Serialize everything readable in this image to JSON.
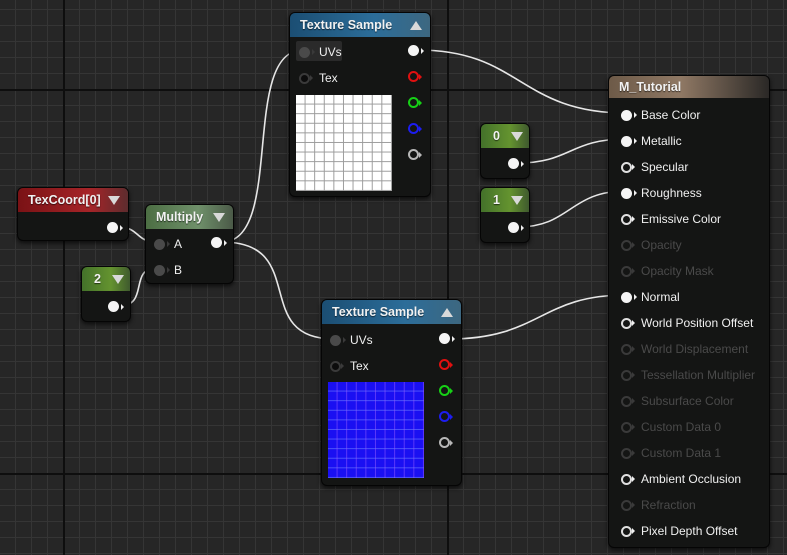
{
  "canvas": {
    "background": "#262626",
    "wire_color": "#e6e6e6"
  },
  "nodes": {
    "texture_sample_top": {
      "title": "Texture Sample",
      "header_color": "#2c6d99",
      "collapse_icon": "triangle-up-icon",
      "inputs": [
        {
          "label": "UVs",
          "connected": true
        },
        {
          "label": "Tex",
          "connected": false
        }
      ],
      "outputs": [
        "rgb",
        "r",
        "g",
        "b",
        "a"
      ],
      "preview": "white-grid-texture"
    },
    "texture_sample_bottom": {
      "title": "Texture Sample",
      "header_color": "#2c6d99",
      "collapse_icon": "triangle-up-icon",
      "inputs": [
        {
          "label": "UVs",
          "connected": true
        },
        {
          "label": "Tex",
          "connected": false
        }
      ],
      "outputs": [
        "rgb",
        "r",
        "g",
        "b",
        "a"
      ],
      "preview": "blue-normal-map-texture"
    },
    "texcoord": {
      "title": "TexCoord[0]",
      "header_color": "#a62428"
    },
    "multiply": {
      "title": "Multiply",
      "header_color": "#6f906a",
      "inputs": [
        {
          "label": "A",
          "connected": true
        },
        {
          "label": "B",
          "connected": true
        }
      ]
    },
    "const_2": {
      "title": "2",
      "header_color": "#64932f"
    },
    "const_0": {
      "title": "0",
      "header_color": "#64932f"
    },
    "const_1": {
      "title": "1",
      "header_color": "#64932f"
    },
    "material": {
      "title": "M_Tutorial",
      "header_color": "#8f7864",
      "inputs": [
        {
          "label": "Base Color",
          "state": "connected"
        },
        {
          "label": "Metallic",
          "state": "connected"
        },
        {
          "label": "Specular",
          "state": "enabled"
        },
        {
          "label": "Roughness",
          "state": "connected"
        },
        {
          "label": "Emissive Color",
          "state": "enabled"
        },
        {
          "label": "Opacity",
          "state": "disabled"
        },
        {
          "label": "Opacity Mask",
          "state": "disabled"
        },
        {
          "label": "Normal",
          "state": "connected"
        },
        {
          "label": "World Position Offset",
          "state": "enabled"
        },
        {
          "label": "World Displacement",
          "state": "disabled"
        },
        {
          "label": "Tessellation Multiplier",
          "state": "disabled"
        },
        {
          "label": "Subsurface Color",
          "state": "disabled"
        },
        {
          "label": "Custom Data 0",
          "state": "disabled"
        },
        {
          "label": "Custom Data 1",
          "state": "disabled"
        },
        {
          "label": "Ambient Occlusion",
          "state": "enabled"
        },
        {
          "label": "Refraction",
          "state": "disabled"
        },
        {
          "label": "Pixel Depth Offset",
          "state": "enabled"
        }
      ]
    }
  },
  "connections": [
    {
      "from": "texcoord.out",
      "to": "multiply.A"
    },
    {
      "from": "const_2.out",
      "to": "multiply.B"
    },
    {
      "from": "multiply.out",
      "to": "texture_sample_top.UVs"
    },
    {
      "from": "multiply.out",
      "to": "texture_sample_bottom.UVs"
    },
    {
      "from": "texture_sample_top.rgb",
      "to": "material.Base Color"
    },
    {
      "from": "const_0.out",
      "to": "material.Metallic"
    },
    {
      "from": "const_1.out",
      "to": "material.Roughness"
    },
    {
      "from": "texture_sample_bottom.rgb",
      "to": "material.Normal"
    }
  ]
}
